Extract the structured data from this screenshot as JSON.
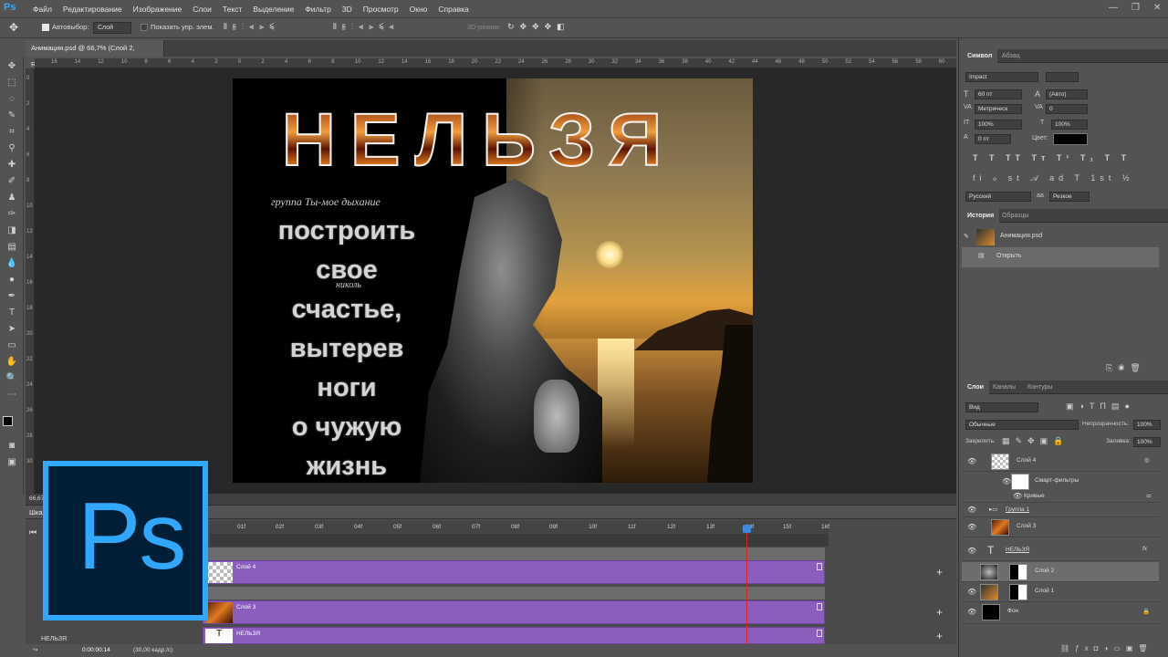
{
  "app": {
    "logo": "Ps"
  },
  "menu": [
    "Файл",
    "Редактирование",
    "Изображение",
    "Слои",
    "Текст",
    "Выделение",
    "Фильтр",
    "3D",
    "Просмотр",
    "Окно",
    "Справка"
  ],
  "options": {
    "autoselect_label": "Автовыбор:",
    "autoselect_value": "Слой",
    "show_controls_label": "Показать упр. элем.",
    "mode3d_label": "3D-режим:"
  },
  "document": {
    "tab_title": "Анимация.psd @ 66,7% (Слой 2, RGB/8)",
    "zoom": "66,67"
  },
  "ruler_h": [
    "16",
    "14",
    "12",
    "10",
    "8",
    "6",
    "4",
    "2",
    "0",
    "2",
    "4",
    "6",
    "8",
    "10",
    "12",
    "14",
    "16",
    "18",
    "20",
    "22",
    "24",
    "26",
    "28",
    "30",
    "32",
    "34",
    "36",
    "38",
    "40",
    "42",
    "44",
    "46",
    "48",
    "50",
    "52",
    "54",
    "56",
    "58",
    "60",
    "62"
  ],
  "ruler_v": [
    "0",
    "2",
    "4",
    "6",
    "8",
    "10",
    "12",
    "14",
    "16",
    "18",
    "20",
    "22",
    "24",
    "26",
    "28",
    "30"
  ],
  "artwork": {
    "title": "НЕЛЬЗЯ",
    "subtitle": "группа Ты-мое дыхание",
    "author": "николь",
    "quote": [
      "построить",
      "свое",
      "счастье,",
      "вытерев",
      "ноги",
      "о чужую",
      "жизнь"
    ]
  },
  "timeline": {
    "header": "Шкала",
    "ticks": [
      "01f",
      "02f",
      "03f",
      "04f",
      "05f",
      "06f",
      "07f",
      "08f",
      "09f",
      "10f",
      "11f",
      "12f",
      "13f",
      "14f",
      "15f",
      "16f"
    ],
    "tracks": [
      {
        "label": "Слой 4"
      },
      {
        "label": "Слой 3"
      },
      {
        "label": "НЕЛЬЗЯ"
      }
    ],
    "bottom_layer": "НЕЛЬЗЯ",
    "timecode": "0:00:00:14",
    "fps": "(30,00 кадр./с)"
  },
  "character": {
    "tab_active": "Символ",
    "tab_other": "Абзац",
    "font": "Impact",
    "size": "60 пт",
    "leading": "(Авто)",
    "kerning": "Метрическ",
    "tracking": "0",
    "vscale": "100%",
    "hscale": "100%",
    "baseline": "0 пт",
    "color_label": "Цвет:",
    "language": "Русский",
    "aa_prefix": "аа",
    "antialias": "Резкое",
    "style_buttons": "T T TT Tт T¹ T₁ T T",
    "otype_buttons": "fi ℴ st 𝒜 ad T 1st ½"
  },
  "history": {
    "tab_active": "История",
    "tab_other": "Образцы",
    "snapshot": "Анимация.psd",
    "items": [
      "Открыть"
    ]
  },
  "layers_panel": {
    "tabs": [
      "Слои",
      "Каналы",
      "Контуры"
    ],
    "filter": "Вид",
    "blend_mode": "Обычные",
    "opacity_label": "Непрозрачность:",
    "opacity": "100%",
    "lock_label": "Закрепить:",
    "fill_label": "Заливка:",
    "fill": "100%",
    "layers": [
      {
        "name": "Слой 4"
      },
      {
        "name": "Смарт-фильтры"
      },
      {
        "name": "Кривые"
      },
      {
        "name": "Группа 1"
      },
      {
        "name": "Слой 3"
      },
      {
        "name": "НЕЛЬЗЯ"
      },
      {
        "name": "Слой 2"
      },
      {
        "name": "Слой 1"
      },
      {
        "name": "Фон"
      }
    ],
    "fx_label": "fx"
  },
  "colors": {
    "accent": "#31a8ff",
    "track": "#8a5dbf",
    "playhead": "#dd2222"
  }
}
